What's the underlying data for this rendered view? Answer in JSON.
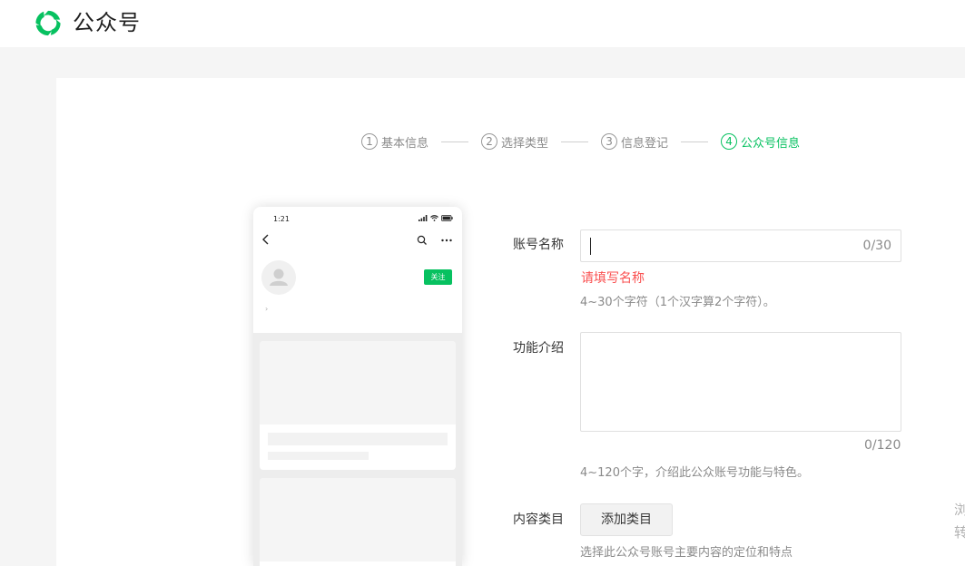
{
  "header": {
    "brand": "公众号",
    "logo_icon": "wechat-official-account-logo-icon",
    "brand_color": "#07c160"
  },
  "steps": [
    {
      "num": "1",
      "label": "基本信息",
      "active": false
    },
    {
      "num": "2",
      "label": "选择类型",
      "active": false
    },
    {
      "num": "3",
      "label": "信息登记",
      "active": false
    },
    {
      "num": "4",
      "label": "公众号信息",
      "active": true
    }
  ],
  "preview": {
    "time": "1:21",
    "follow_label": "关注",
    "intro_arrow": "›",
    "icons": [
      "signal-icon",
      "wifi-icon",
      "battery-icon",
      "back-icon",
      "search-icon",
      "more-icon",
      "avatar-placeholder-icon"
    ]
  },
  "form": {
    "account_name": {
      "label": "账号名称",
      "value": "",
      "counter": "0/30",
      "error": "请填写名称",
      "hint": "4~30个字符（1个汉字算2个字符）。"
    },
    "intro": {
      "label": "功能介绍",
      "value": "",
      "counter": "0/120",
      "hint": "4~120个字，介绍此公众账号功能与特色。"
    },
    "category": {
      "label": "内容类目",
      "button_label": "添加类目",
      "hint": "选择此公众号账号主要内容的定位和特点"
    }
  },
  "edge_text": [
    "浏",
    "转"
  ],
  "colors": {
    "accent": "#07c160",
    "error": "#fa5151",
    "hint": "#8a8a8a"
  }
}
